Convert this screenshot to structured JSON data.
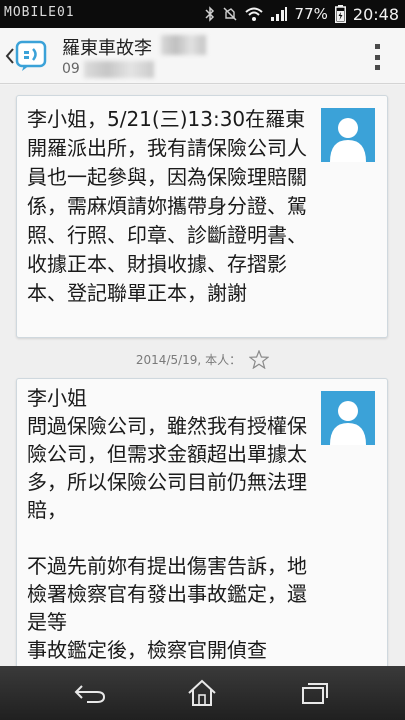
{
  "status_bar": {
    "watermark": "MOBILE01",
    "battery_percent": "77%",
    "time": "20:48",
    "icons": [
      "bluetooth-icon",
      "mute-icon",
      "wifi-icon",
      "signal-icon",
      "battery-icon"
    ]
  },
  "header": {
    "contact_name": "羅東車故李",
    "contact_number": "09",
    "icons": [
      "back-chevron-icon",
      "messaging-app-icon",
      "overflow-menu-icon"
    ]
  },
  "messages": [
    {
      "text": "李小姐，5/21(三)13:30在羅東開羅派出所，我有請保險公司人員也一起參與，因為保險理賠關係，需麻煩請妳攜帶身分證、駕照、行照、印章、診斷證明書、收據正本、財損收據、存摺影本、登記聯單正本，謝謝",
      "timestamp": "2014/5/19, 本人："
    },
    {
      "text": "李小姐\n問過保險公司，雖然我有授權保險公司，但需求金額超出單據太多，所以保險公司目前仍無法理賠，\n\n不過先前妳有提出傷害告訴，地檢署檢察官有發出事故鑑定，還是等\n事故鑑定後，檢察官開偵查"
    }
  ],
  "nav": {
    "icons": [
      "back-icon",
      "home-icon",
      "recent-apps-icon"
    ]
  },
  "colors": {
    "avatar_bg": "#3ba2d8",
    "status_bar_bg": "#0c0c0c",
    "nav_bar_bg": "#2a2a2a",
    "bubble_border": "#cfd8de"
  }
}
